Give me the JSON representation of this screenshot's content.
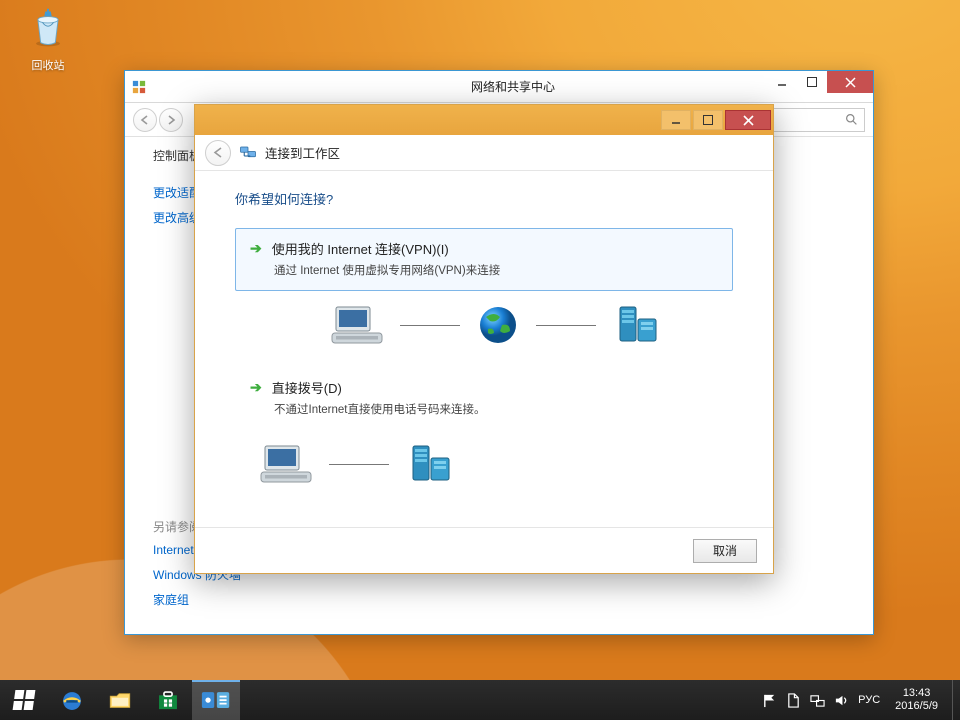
{
  "desktop": {
    "recycle_label": "回收站"
  },
  "parent": {
    "title": "网络和共享中心",
    "breadcrumb": "控制面板",
    "link_change_adapter": "更改适配",
    "link_change_advanced": "更改高级",
    "see_also": "另请参阅",
    "link_internet": "Internet 选项",
    "link_firewall": "Windows 防火墙",
    "link_homegroup": "家庭组"
  },
  "wizard": {
    "title": "连接到工作区",
    "heading": "你希望如何连接?",
    "opt1_title": "使用我的 Internet 连接(VPN)(I)",
    "opt1_desc": "通过 Internet 使用虚拟专用网络(VPN)来连接",
    "opt2_title": "直接拨号(D)",
    "opt2_desc": "不通过Internet直接使用电话号码来连接。",
    "cancel": "取消"
  },
  "tray": {
    "ime": "РУС",
    "time": "13:43",
    "date": "2016/5/9"
  }
}
